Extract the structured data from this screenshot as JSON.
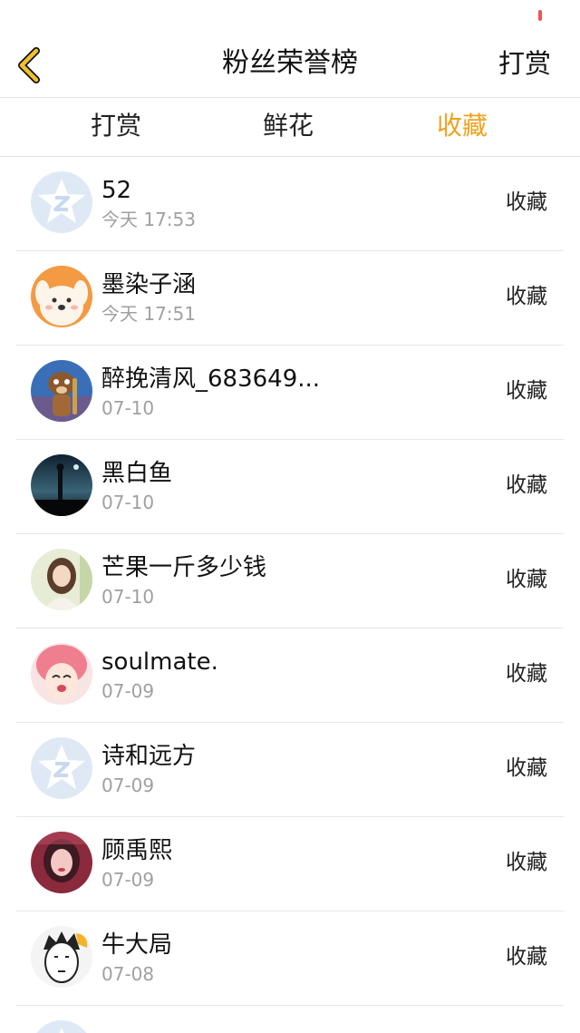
{
  "nav": {
    "title": "粉丝荣誉榜",
    "action_label": "打赏"
  },
  "tabs": [
    {
      "label": "打赏",
      "active": false
    },
    {
      "label": "鲜花",
      "active": false
    },
    {
      "label": "收藏",
      "active": true
    }
  ],
  "colors": {
    "accent": "#f0a21e",
    "back_icon": "#f0c02e",
    "divider": "#e6e6e6",
    "secondary_text": "#a0a0a0"
  },
  "fans": [
    {
      "name": "52",
      "time": "今天 17:53",
      "type": "收藏",
      "avatar": "default-qq-avatar"
    },
    {
      "name": "墨染子涵",
      "time": "今天 17:51",
      "type": "收藏",
      "avatar": "cartoon-dog-avatar"
    },
    {
      "name": "醉挽清风_683649...",
      "time": "07-10",
      "type": "收藏",
      "avatar": "cartoon-squirrel-avatar"
    },
    {
      "name": "黑白鱼",
      "time": "07-10",
      "type": "收藏",
      "avatar": "night-scene-avatar"
    },
    {
      "name": "芒果一斤多少钱",
      "time": "07-10",
      "type": "收藏",
      "avatar": "girl-photo-avatar"
    },
    {
      "name": "soulmate.",
      "time": "07-09",
      "type": "收藏",
      "avatar": "anime-girl-avatar"
    },
    {
      "name": "诗和远方",
      "time": "07-09",
      "type": "收藏",
      "avatar": "default-qq-avatar"
    },
    {
      "name": "顾禹熙",
      "time": "07-09",
      "type": "收藏",
      "avatar": "girl-portrait-avatar"
    },
    {
      "name": "牛大局",
      "time": "07-08",
      "type": "收藏",
      "avatar": "cartoon-boy-avatar"
    }
  ],
  "partial_row": {
    "avatar": "default-qq-avatar"
  }
}
